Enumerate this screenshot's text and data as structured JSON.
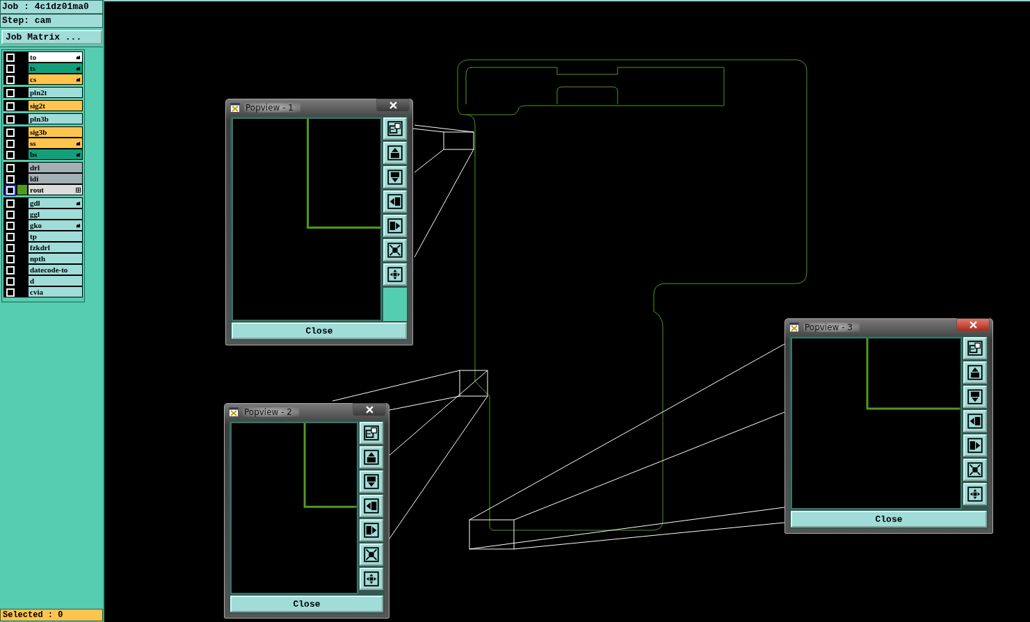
{
  "job": {
    "label": "Job : 4c1dz01ma0"
  },
  "step": {
    "label": "Step: cam"
  },
  "job_matrix_button": "Job Matrix ...",
  "layer_groups": [
    {
      "layers": [
        {
          "name": "to",
          "color": "#ffffff",
          "affected": true,
          "selected": false,
          "checked": false
        },
        {
          "name": "ts",
          "color": "#12a07a",
          "affected": true,
          "selected": false,
          "checked": false
        },
        {
          "name": "cs",
          "color": "#ffc44f",
          "affected": true,
          "selected": false,
          "checked": false
        }
      ]
    },
    {
      "layers": [
        {
          "name": "pln2t",
          "color": "#a0dcd8",
          "affected": false,
          "selected": false,
          "checked": false
        }
      ]
    },
    {
      "layers": [
        {
          "name": "sig2t",
          "color": "#ffc44f",
          "affected": false,
          "selected": false,
          "checked": false
        }
      ]
    },
    {
      "layers": [
        {
          "name": "pln3b",
          "color": "#a0dcd8",
          "affected": false,
          "selected": false,
          "checked": false
        }
      ]
    },
    {
      "layers": [
        {
          "name": "sig3b",
          "color": "#ffc44f",
          "affected": false,
          "selected": false,
          "checked": false
        },
        {
          "name": "ss",
          "color": "#ffc44f",
          "affected": true,
          "selected": false,
          "checked": false
        },
        {
          "name": "bs",
          "color": "#12a07a",
          "affected": true,
          "selected": false,
          "checked": false
        }
      ]
    },
    {
      "layers": [
        {
          "name": "drl",
          "color": "#a3b0b6",
          "affected": false,
          "selected": false,
          "checked": false
        },
        {
          "name": "ldi",
          "color": "#a3b0b6",
          "affected": false,
          "selected": false,
          "checked": false
        },
        {
          "name": "rout",
          "color": "#dcdcdc",
          "affected": false,
          "selected": true,
          "checked": false
        }
      ]
    },
    {
      "layers": [
        {
          "name": "gdl",
          "color": "#a0dcd8",
          "affected": true,
          "selected": false,
          "checked": false
        },
        {
          "name": "ggl",
          "color": "#a0dcd8",
          "affected": false,
          "selected": false,
          "checked": false
        },
        {
          "name": "gko",
          "color": "#a0dcd8",
          "affected": true,
          "selected": false,
          "checked": false
        },
        {
          "name": "tp",
          "color": "#a0dcd8",
          "affected": false,
          "selected": false,
          "checked": false
        },
        {
          "name": "fzkdrl",
          "color": "#a0dcd8",
          "affected": false,
          "selected": false,
          "checked": false
        },
        {
          "name": "npth",
          "color": "#a0dcd8",
          "affected": false,
          "selected": false,
          "checked": false
        },
        {
          "name": "datecode-to",
          "color": "#a0dcd8",
          "affected": false,
          "selected": false,
          "checked": false
        },
        {
          "name": "d",
          "color": "#a0dcd8",
          "affected": false,
          "selected": false,
          "checked": false
        },
        {
          "name": "cvia",
          "color": "#a0dcd8",
          "affected": false,
          "selected": false,
          "checked": false
        }
      ]
    }
  ],
  "status_bar": "Selected : 0",
  "popviews": [
    {
      "title": "Popview - 1",
      "active": false,
      "close_button": "Close"
    },
    {
      "title": "Popview - 2",
      "active": false,
      "close_button": "Close"
    },
    {
      "title": "Popview - 3",
      "active": true,
      "close_button": "Close"
    }
  ]
}
